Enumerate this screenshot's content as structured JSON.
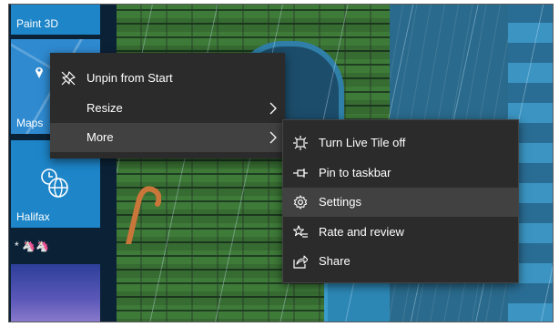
{
  "tiles": {
    "paint3d_label": "Paint 3D",
    "maps_label": "Maps",
    "halifax_label": "Halifax",
    "mini_strip_text": "* 🦄🦄"
  },
  "context_menu": {
    "items": [
      {
        "label": "Unpin from Start",
        "icon": "unpin-icon"
      },
      {
        "label": "Resize",
        "icon": "",
        "submenu": true
      },
      {
        "label": "More",
        "icon": "",
        "submenu": true,
        "highlighted": true
      }
    ]
  },
  "more_submenu": {
    "items": [
      {
        "label": "Turn Live Tile off",
        "icon": "live-tile-icon"
      },
      {
        "label": "Pin to taskbar",
        "icon": "pin-taskbar-icon"
      },
      {
        "label": "Settings",
        "icon": "gear-icon",
        "highlighted": true
      },
      {
        "label": "Rate and review",
        "icon": "rate-review-icon"
      },
      {
        "label": "Share",
        "icon": "share-icon"
      }
    ]
  },
  "colors": {
    "menu_bg": "#2b2b2b",
    "menu_highlight": "#414141",
    "tile_blue": "#1d85c8",
    "menu_text": "#ffffff"
  }
}
